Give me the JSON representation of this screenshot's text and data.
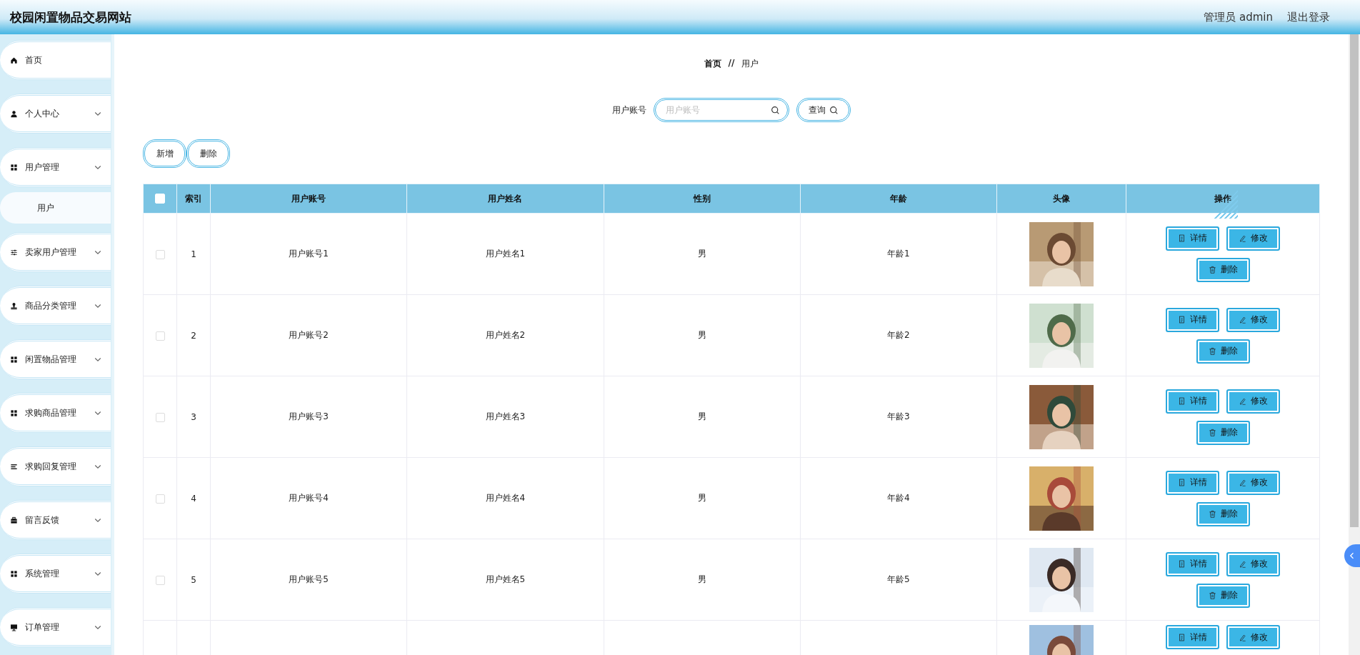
{
  "header": {
    "title": "校园闲置物品交易网站",
    "user": "管理员 admin",
    "logout": "退出登录"
  },
  "sidebar": {
    "items": [
      {
        "label": "首页",
        "kind": "link"
      },
      {
        "label": "个人中心",
        "kind": "group"
      },
      {
        "label": "用户管理",
        "kind": "group",
        "children": [
          {
            "label": "用户"
          }
        ]
      },
      {
        "label": "卖家用户管理",
        "kind": "group"
      },
      {
        "label": "商品分类管理",
        "kind": "group"
      },
      {
        "label": "闲置物品管理",
        "kind": "group"
      },
      {
        "label": "求购商品管理",
        "kind": "group"
      },
      {
        "label": "求购回复管理",
        "kind": "group"
      },
      {
        "label": "留言反馈",
        "kind": "group"
      },
      {
        "label": "系统管理",
        "kind": "group"
      },
      {
        "label": "订单管理",
        "kind": "group"
      }
    ]
  },
  "breadcrumb": {
    "items": [
      "首页",
      "用户"
    ],
    "separator": "//"
  },
  "search": {
    "label": "用户账号",
    "placeholder": "用户账号",
    "button": "查询"
  },
  "toolbar": {
    "buttons": [
      "新增",
      "删除"
    ]
  },
  "table": {
    "select_all": {
      "checked": false
    },
    "columns": [
      "索引",
      "用户账号",
      "用户姓名",
      "性别",
      "年龄",
      "头像",
      "操作"
    ],
    "rows": [
      {
        "checked": false,
        "index": "1",
        "account": "用户账号1",
        "name": "用户姓名1",
        "gender": "男",
        "age": "年龄1",
        "avatar": {
          "kind": "picture"
        },
        "actions": [
          "详情",
          "修改",
          "删除"
        ]
      },
      {
        "checked": false,
        "index": "2",
        "account": "用户账号2",
        "name": "用户姓名2",
        "gender": "男",
        "age": "年龄2",
        "avatar": {
          "kind": "picture"
        },
        "actions": [
          "详情",
          "修改",
          "删除"
        ]
      },
      {
        "checked": false,
        "index": "3",
        "account": "用户账号3",
        "name": "用户姓名3",
        "gender": "男",
        "age": "年龄3",
        "avatar": {
          "kind": "picture"
        },
        "actions": [
          "详情",
          "修改",
          "删除"
        ]
      },
      {
        "checked": false,
        "index": "4",
        "account": "用户账号4",
        "name": "用户姓名4",
        "gender": "男",
        "age": "年龄4",
        "avatar": {
          "kind": "picture"
        },
        "actions": [
          "详情",
          "修改",
          "删除"
        ]
      },
      {
        "checked": false,
        "index": "5",
        "account": "用户账号5",
        "name": "用户姓名5",
        "gender": "男",
        "age": "年龄5",
        "avatar": {
          "kind": "picture"
        },
        "actions": [
          "详情",
          "修改",
          "删除"
        ]
      },
      {
        "avatar": {
          "kind": "picture"
        },
        "actions": [
          "详情",
          "修改"
        ]
      }
    ]
  }
}
